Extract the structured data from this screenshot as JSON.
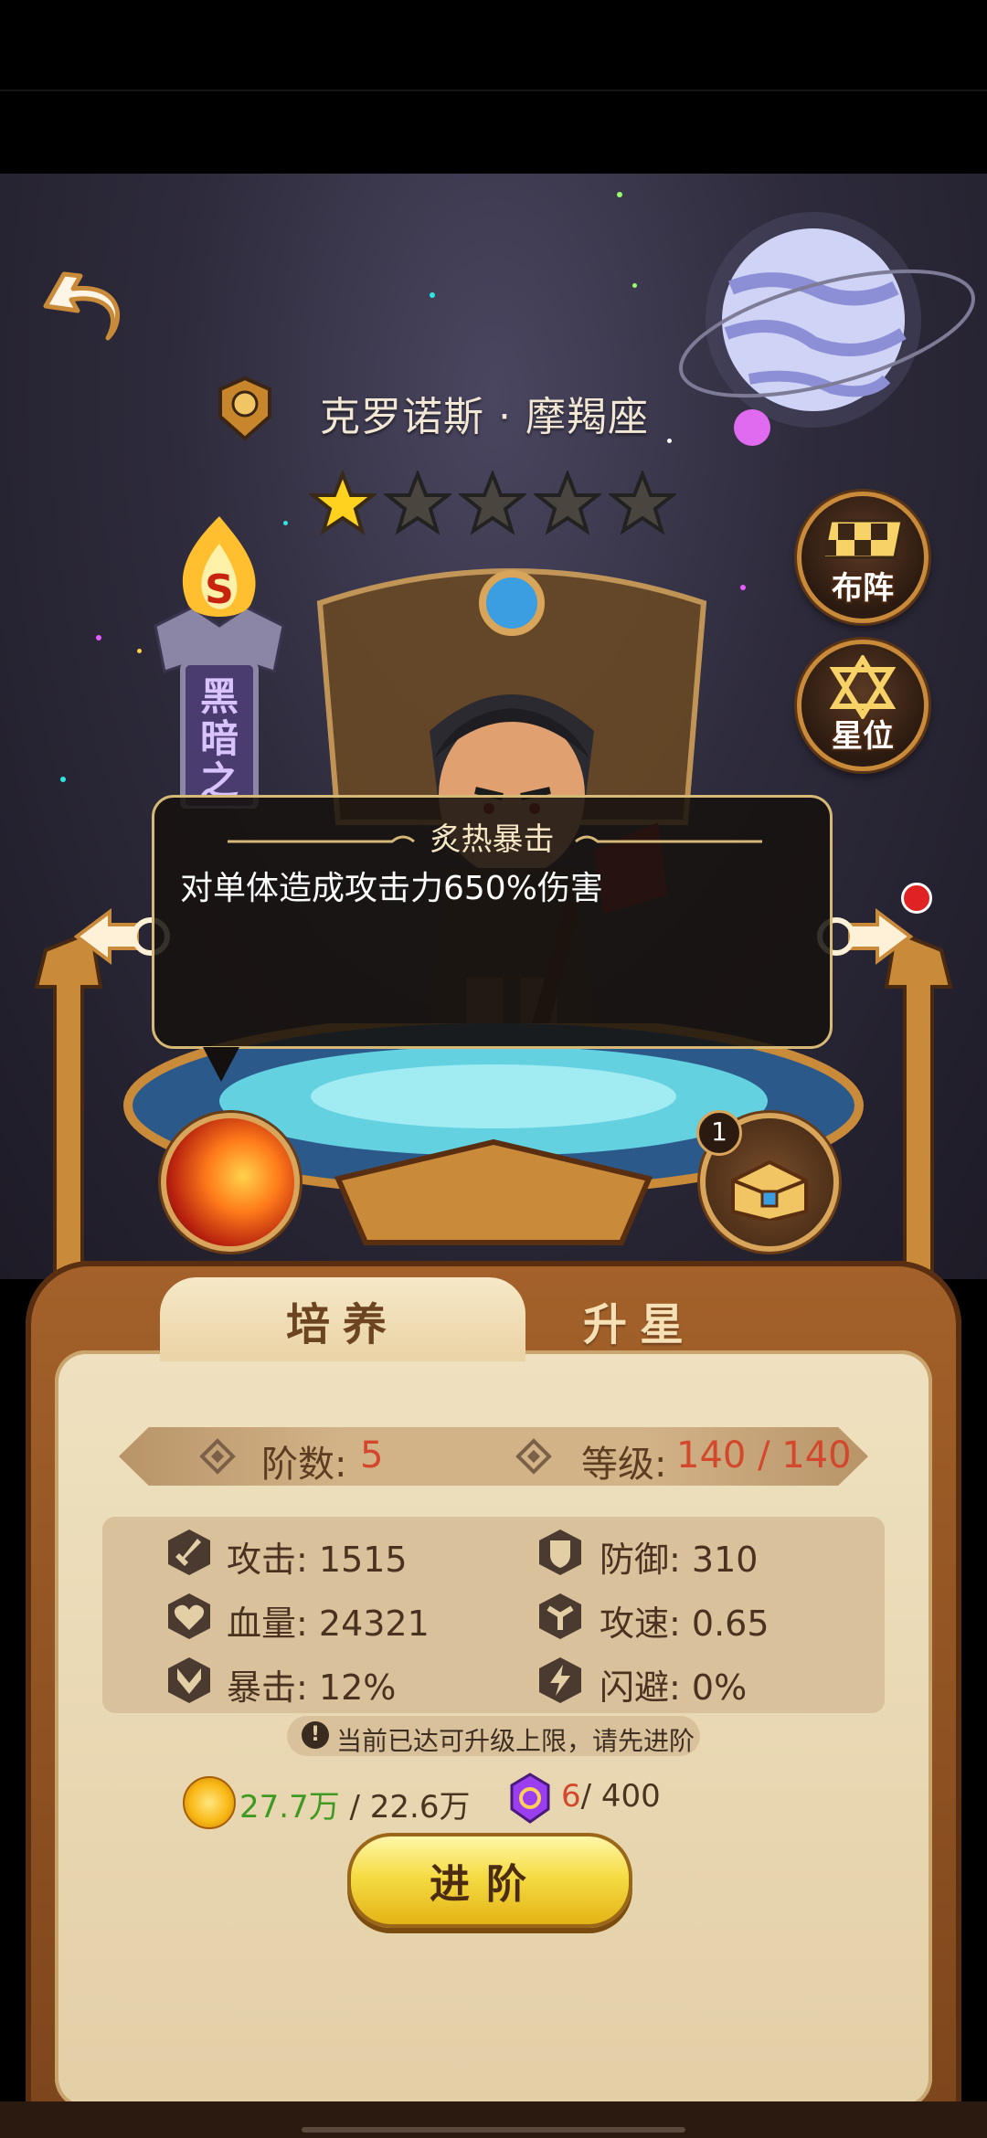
{
  "hero": {
    "name": "克罗诺斯 · 摩羯座",
    "stars_filled": 1,
    "stars_total": 5,
    "rank_letter": "S",
    "title_chars": "黑暗之神"
  },
  "side_buttons": {
    "formation_label": "布阵",
    "constellation_label": "星位"
  },
  "skill_tooltip": {
    "name": "炙热暴击",
    "description": "对单体造成攻击力650%伤害"
  },
  "equipment_badge": "1",
  "tabs": {
    "train": "培养",
    "star_up": "升星",
    "active": "train"
  },
  "level_info": {
    "rank_label": "阶数:",
    "rank_value": "5",
    "level_label": "等级:",
    "level_value": "140 / 140"
  },
  "stats": {
    "attack_label": "攻击:",
    "attack_value": "1515",
    "defense_label": "防御:",
    "defense_value": "310",
    "hp_label": "血量:",
    "hp_value": "24321",
    "attack_speed_label": "攻速:",
    "attack_speed_value": "0.65",
    "crit_label": "暴击:",
    "crit_value": "12%",
    "dodge_label": "闪避:",
    "dodge_value": "0%"
  },
  "notice": "当前已达可升级上限，请先进阶",
  "costs": {
    "gold_have": "27.7万",
    "gold_need": "/ 22.6万",
    "gem_have": "6",
    "gem_need": "/ 400"
  },
  "advance_button": "进阶",
  "colors": {
    "panel_bg": "#efe1c0",
    "panel_frame": "#a4612a",
    "accent_red": "#d3482d",
    "accent_green": "#3f9a23",
    "button_gold": "#f5dc45"
  }
}
